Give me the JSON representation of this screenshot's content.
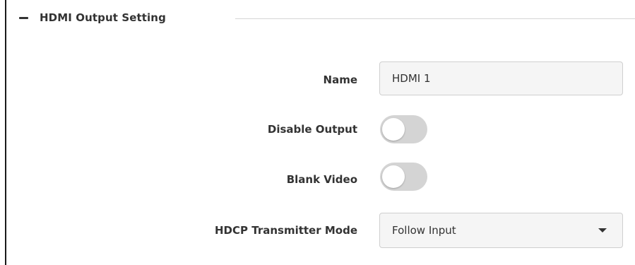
{
  "section": {
    "title": "HDMI Output Setting",
    "collapse_icon": "minus-icon"
  },
  "fields": {
    "name": {
      "label": "Name",
      "value": "HDMI 1"
    },
    "disable_output": {
      "label": "Disable Output",
      "checked": false
    },
    "blank_video": {
      "label": "Blank Video",
      "checked": false
    },
    "hdcp_mode": {
      "label": "HDCP Transmitter Mode",
      "selected": "Follow Input",
      "caret_icon": "caret-down-icon"
    }
  },
  "colors": {
    "toggle_off": "#d4d4d4",
    "field_background": "#f5f5f5",
    "text": "#333333"
  }
}
